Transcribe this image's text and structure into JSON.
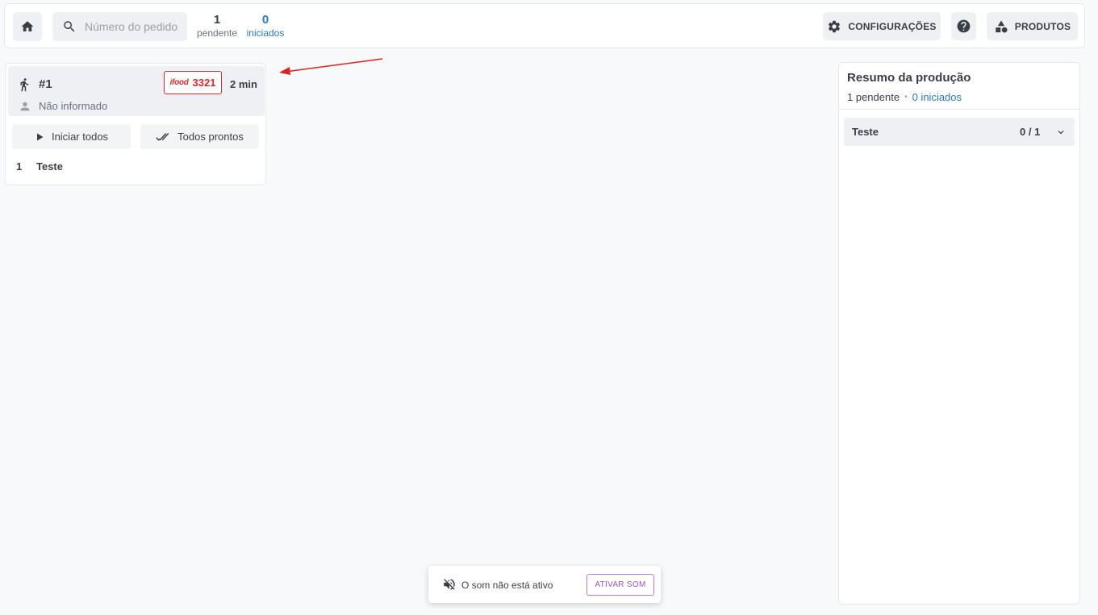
{
  "topbar": {
    "search_placeholder": "Número do pedido",
    "pending_count": "1",
    "pending_label": "pendente",
    "started_count": "0",
    "started_label": "iniciados",
    "config_label": "CONFIGURAÇÕES",
    "products_label": "PRODUTOS"
  },
  "order": {
    "number": "#1",
    "channel_brand": "ifood",
    "channel_code": "3321",
    "elapsed": "2 min",
    "customer": "Não informado",
    "start_all_label": "Iniciar todos",
    "all_ready_label": "Todos prontos",
    "items": [
      {
        "qty": "1",
        "name": "Teste"
      }
    ]
  },
  "summary": {
    "title": "Resumo da produção",
    "pending": "1 pendente",
    "separator": "•",
    "started": "0 iniciados",
    "rows": [
      {
        "name": "Teste",
        "count": "0 / 1"
      }
    ]
  },
  "toast": {
    "message": "O som não está ativo",
    "action_label": "ATIVAR SOM"
  },
  "colors": {
    "accent_blue": "#2a7ab8",
    "ifood_red": "#d42c2c",
    "annotation_arrow": "#e02020",
    "toast_action": "#9b59b6"
  }
}
